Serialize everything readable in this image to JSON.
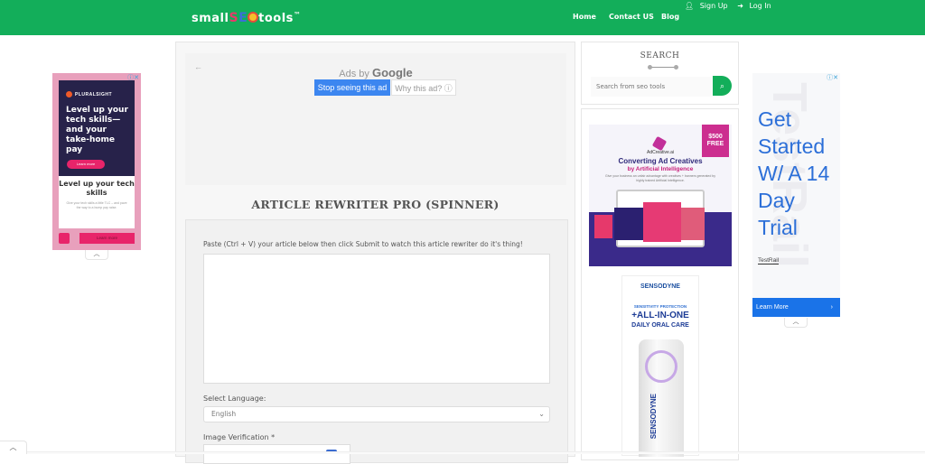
{
  "header": {
    "logo": {
      "prefix": "small",
      "seo": "SEO",
      "suffix": "tools",
      "tm": "™"
    },
    "auth": {
      "signup": "Sign Up",
      "login": "Log In"
    },
    "nav": [
      {
        "label": "Home"
      },
      {
        "label": "Contact US"
      },
      {
        "label": "Blog"
      }
    ]
  },
  "main": {
    "ad_banner": {
      "back_icon": "←",
      "ads_by": "Ads by",
      "google": "Google",
      "stop_label": "Stop seeing this ad",
      "why_label": "Why this ad? ⓘ"
    },
    "tool_title": "ARTICLE REWRITER PRO (SPINNER)",
    "form": {
      "paste_label": "Paste (Ctrl + V) your article below then click Submit to watch this article rewriter do it's thing!",
      "article_value": "",
      "language_label": "Select Language:",
      "language_selected": "English",
      "verification_label": "Image Verification *"
    }
  },
  "sidebar": {
    "search": {
      "title": "SEARCH",
      "placeholder": "Search from seo tools",
      "button_icon": "search-icon"
    },
    "ad1": {
      "badge": "$500 FREE",
      "brand": "AdCreative.ai",
      "headline": "Converting Ad Creatives",
      "headline2": "by Artificial Intelligence",
      "sub": "Give your business an unfair advantage with creatives + banners generated by highly trained Artificial Intelligence."
    },
    "ad2": {
      "brand": "SENSODYNE",
      "line1": "SENSITIVITY PROTECTION",
      "line2": "+ALL-IN-ONE",
      "line3": "DAILY ORAL CARE",
      "tube_text": "SENSODYNE"
    }
  },
  "left_ad": {
    "brand": "PLURALSIGHT",
    "headline": "Level up your tech skills— and your take-home pay",
    "cta1": "Learn more",
    "headline2": "Level up your tech skills",
    "sub": "Give your tech skills a little TLC – and pave the way to a bump pay raise.",
    "cta2": "Learn more",
    "adchoices": "ⓘ✕",
    "collapse": "︿"
  },
  "right_ad": {
    "bg_text": "TestRail",
    "headline": "Get Started W/ A 14 Day Trial",
    "brand": "TestRail",
    "cta": "Learn More",
    "cta_chevron": "›",
    "adchoices": "ⓘ✕",
    "collapse": "︿"
  },
  "bottom_tab": "︿"
}
